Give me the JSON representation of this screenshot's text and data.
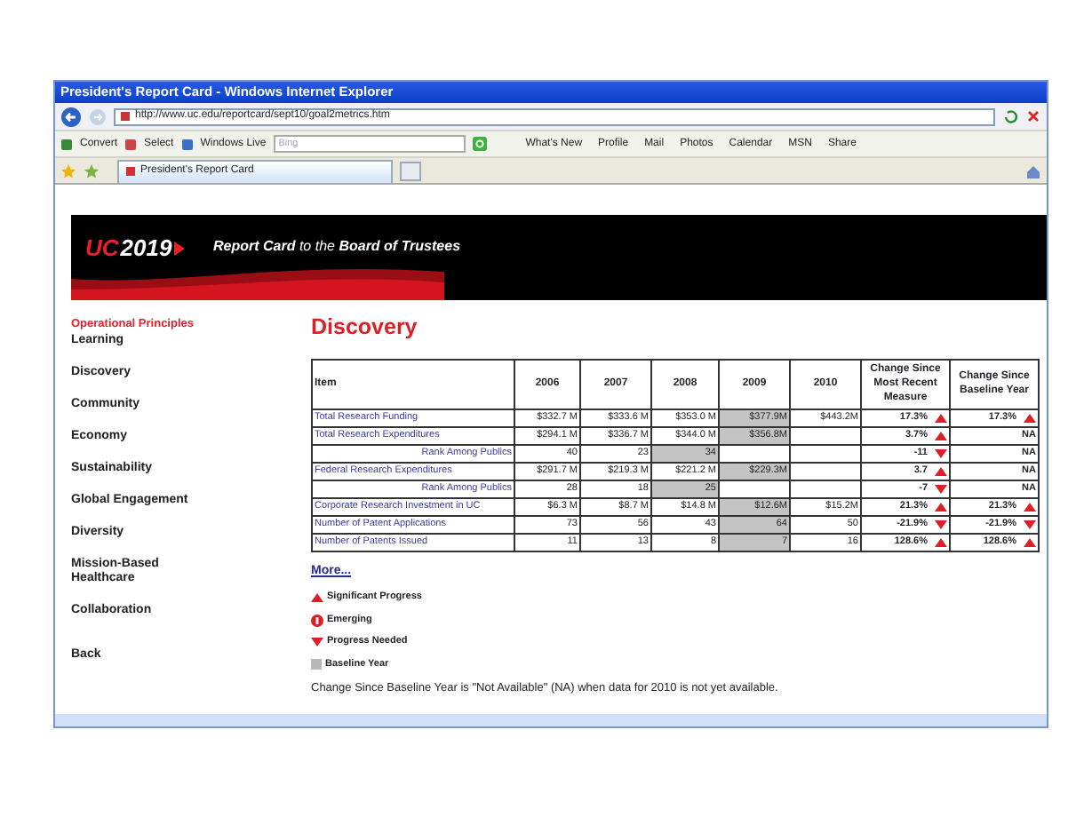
{
  "browser": {
    "title": "President's Report Card - Windows Internet Explorer",
    "address": "http://www.uc.edu/reportcard/sept10/goal2metrics.htm",
    "toolbar": {
      "buttons": [
        "Convert",
        "Select",
        "Windows Live"
      ],
      "search_placeholder": "Bing",
      "links": [
        "What's New",
        "Profile",
        "Mail",
        "Photos",
        "Calendar",
        "MSN",
        "Share"
      ]
    },
    "tabs": [
      {
        "label": "President's Report Card",
        "selected": true
      }
    ]
  },
  "banner": {
    "logo_prefix": "UC",
    "logo_year": "2019",
    "tagline": "**Report Card** to the **Board of Trustees**"
  },
  "sidebar": {
    "heading": "Operational Principles",
    "items": [
      "Learning",
      "Discovery",
      "Community",
      "Economy",
      "Sustainability",
      "Global Engagement",
      "Diversity",
      "Mission-Based Healthcare",
      "Collaboration",
      "Back"
    ]
  },
  "main": {
    "title": "Discovery",
    "table": {
      "columns": [
        "Item",
        "2006",
        "2007",
        "2008",
        "2009",
        "2010",
        "Change Since Most Recent Measure",
        "Change Since Baseline Year"
      ],
      "rows": [
        {
          "kind": "metric",
          "item": "Total Research Funding",
          "values": [
            {
              "text": "$332.7 M",
              "baseline": false
            },
            {
              "text": "$333.6 M",
              "baseline": false
            },
            {
              "text": "$353.0 M",
              "baseline": false
            },
            {
              "text": "$377.9M",
              "baseline": true
            },
            {
              "text": "$443.2M",
              "baseline": false
            }
          ],
          "changes": [
            {
              "text": "17.3%",
              "kind": "up"
            },
            {
              "text": "17.3%",
              "kind": "up"
            }
          ]
        },
        {
          "kind": "metric",
          "item": "Total Research Expenditures",
          "values": [
            {
              "text": "$294.1 M",
              "baseline": false
            },
            {
              "text": "$336.7 M",
              "baseline": false
            },
            {
              "text": "$344.0 M",
              "baseline": false
            },
            {
              "text": "$356.8M",
              "baseline": true
            },
            {
              "baseline": false
            }
          ],
          "changes": [
            {
              "text": "3.7%",
              "kind": "up"
            },
            {
              "text": "NA",
              "kind": "none"
            }
          ]
        },
        {
          "kind": "sub",
          "item": "Rank Among Publics",
          "values": [
            {
              "text": "40",
              "baseline": false
            },
            {
              "text": "23",
              "baseline": false
            },
            {
              "text": "34",
              "baseline": true
            },
            {
              "baseline": false
            },
            {
              "baseline": false
            }
          ],
          "changes": [
            {
              "text": "-11",
              "kind": "down"
            },
            {
              "text": "NA",
              "kind": "none"
            }
          ]
        },
        {
          "kind": "metric",
          "item": "Federal Research Expenditures",
          "values": [
            {
              "text": "$291.7 M",
              "baseline": false
            },
            {
              "text": "$219.3 M",
              "baseline": false
            },
            {
              "text": "$221.2 M",
              "baseline": false
            },
            {
              "text": "$229.3M",
              "baseline": true
            },
            {
              "baseline": false
            }
          ],
          "changes": [
            {
              "text": "3.7",
              "kind": "up"
            },
            {
              "text": "NA",
              "kind": "none"
            }
          ]
        },
        {
          "kind": "sub",
          "item": "Rank Among Publics",
          "values": [
            {
              "text": "28",
              "baseline": false
            },
            {
              "text": "18",
              "baseline": false
            },
            {
              "text": "25",
              "baseline": true
            },
            {
              "baseline": false
            },
            {
              "baseline": false
            }
          ],
          "changes": [
            {
              "text": "-7",
              "kind": "down"
            },
            {
              "text": "NA",
              "kind": "none"
            }
          ]
        },
        {
          "kind": "metric",
          "item": "Corporate Research Investment in UC",
          "values": [
            {
              "text": "$6.3 M",
              "baseline": false
            },
            {
              "text": "$8.7 M",
              "baseline": false
            },
            {
              "text": "$14.8 M",
              "baseline": false
            },
            {
              "text": "$12.6M",
              "baseline": true
            },
            {
              "text": "$15.2M",
              "baseline": false
            }
          ],
          "changes": [
            {
              "text": "21.3%",
              "kind": "up"
            },
            {
              "text": "21.3%",
              "kind": "up"
            }
          ]
        },
        {
          "kind": "metric",
          "item": "Number of Patent Applications",
          "values": [
            {
              "text": "73",
              "baseline": false
            },
            {
              "text": "56",
              "baseline": false
            },
            {
              "text": "43",
              "baseline": false
            },
            {
              "text": "64",
              "baseline": true
            },
            {
              "text": "50",
              "baseline": false
            }
          ],
          "changes": [
            {
              "text": "-21.9%",
              "kind": "down"
            },
            {
              "text": "-21.9%",
              "kind": "down"
            }
          ]
        },
        {
          "kind": "metric",
          "item": "Number of Patents Issued",
          "values": [
            {
              "text": "11",
              "baseline": false
            },
            {
              "text": "13",
              "baseline": false
            },
            {
              "text": "8",
              "baseline": false
            },
            {
              "text": "7",
              "baseline": true
            },
            {
              "text": "16",
              "baseline": false
            }
          ],
          "changes": [
            {
              "text": "128.6%",
              "kind": "up"
            },
            {
              "text": "128.6%",
              "kind": "up"
            }
          ]
        }
      ]
    },
    "more_link": "More...",
    "legend": [
      {
        "kind": "up",
        "label": "Significant Progress"
      },
      {
        "kind": "emerging",
        "label": "Emerging"
      },
      {
        "kind": "down",
        "label": "Progress Needed"
      },
      {
        "kind": "baseline",
        "label": "Baseline Year"
      }
    ],
    "note": "Change Since Baseline Year is \"Not Available\" (NA) when data for 2010 is not yet available."
  }
}
